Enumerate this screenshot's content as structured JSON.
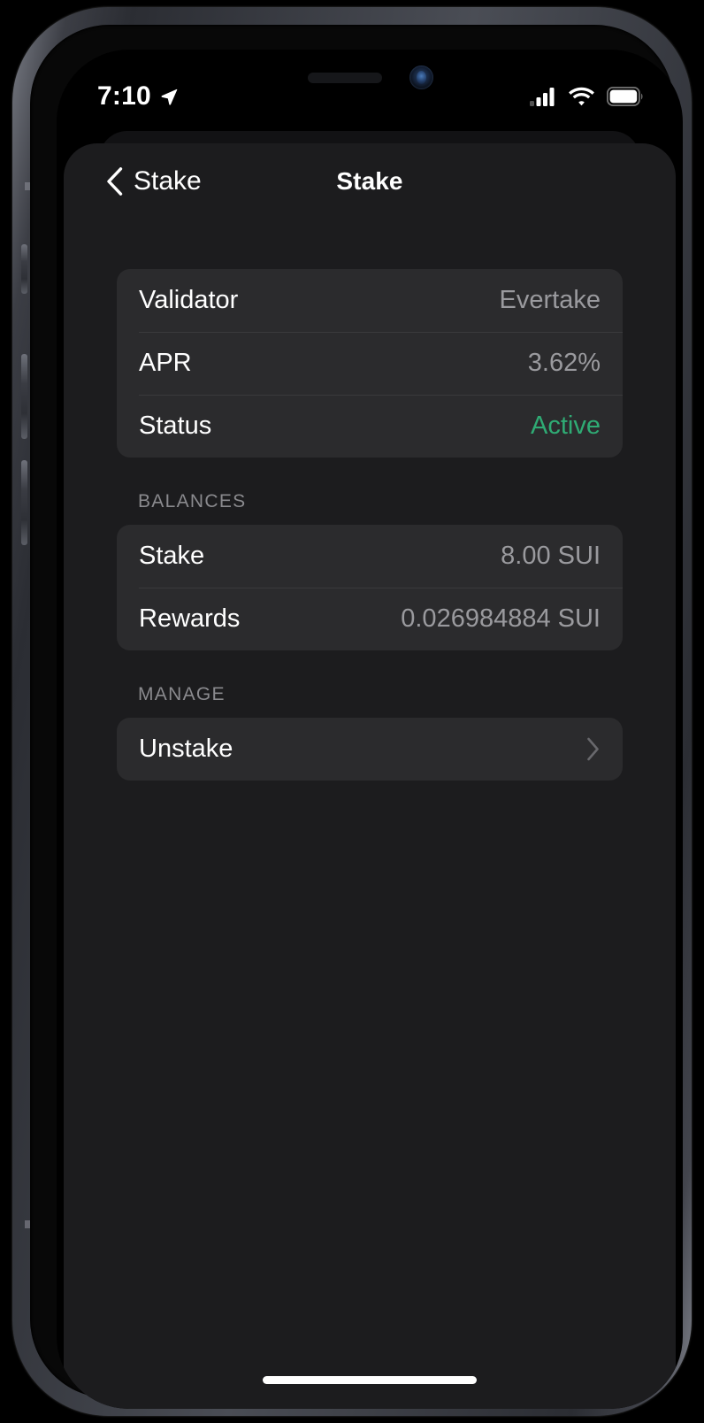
{
  "status_bar": {
    "time": "7:10",
    "location_icon": "location-arrow-icon",
    "cellular_icon": "cellular-signal-icon",
    "cellular_bars_filled": 3,
    "cellular_bars_total": 4,
    "wifi_icon": "wifi-icon",
    "battery_icon": "battery-full-icon"
  },
  "nav": {
    "back_label": "Stake",
    "back_icon": "chevron-left-icon",
    "title": "Stake"
  },
  "details": {
    "rows": [
      {
        "label": "Validator",
        "value": "Evertake",
        "style": "muted"
      },
      {
        "label": "APR",
        "value": "3.62%",
        "style": "muted"
      },
      {
        "label": "Status",
        "value": "Active",
        "style": "green"
      }
    ]
  },
  "balances": {
    "header": "BALANCES",
    "rows": [
      {
        "label": "Stake",
        "value": "8.00 SUI"
      },
      {
        "label": "Rewards",
        "value": "0.026984884 SUI"
      }
    ]
  },
  "manage": {
    "header": "MANAGE",
    "rows": [
      {
        "label": "Unstake",
        "chevron": "chevron-right-icon"
      }
    ]
  },
  "colors": {
    "accent_green": "#2fab74",
    "sheet_background": "#1c1c1e",
    "card_background": "#2b2b2d",
    "value_text": "#9a9a9e",
    "section_header_text": "#8a8a8e"
  }
}
